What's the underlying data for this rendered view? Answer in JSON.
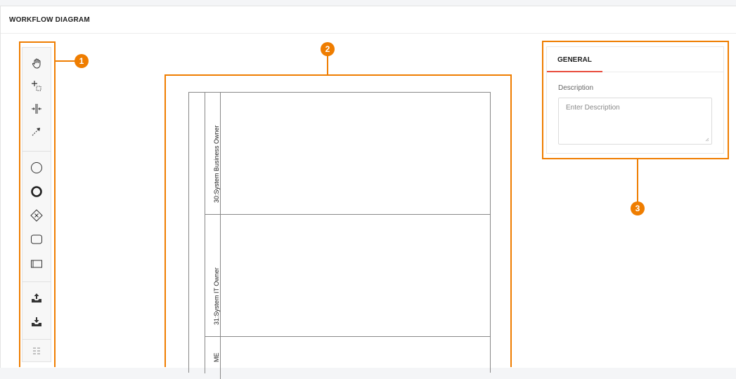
{
  "header": {
    "title": "WORKFLOW DIAGRAM"
  },
  "callouts": [
    "1",
    "2",
    "3"
  ],
  "toolbar": {
    "tools": [
      {
        "icon": "hand-tool-icon"
      },
      {
        "icon": "lasso-tool-icon"
      },
      {
        "icon": "space-tool-icon"
      },
      {
        "icon": "connect-tool-icon"
      },
      {
        "icon": "start-event-icon"
      },
      {
        "icon": "end-event-icon"
      },
      {
        "icon": "gateway-icon"
      },
      {
        "icon": "task-icon"
      },
      {
        "icon": "pool-icon"
      },
      {
        "icon": "upload-icon"
      },
      {
        "icon": "download-icon"
      },
      {
        "icon": "more-options-icon"
      }
    ]
  },
  "canvas": {
    "lanes": [
      {
        "label": "30:System Business Owner"
      },
      {
        "label": "31:System IT Owner"
      },
      {
        "label": "ME"
      }
    ]
  },
  "properties": {
    "tab": "GENERAL",
    "description_label": "Description",
    "description_placeholder": "Enter Description"
  },
  "colors": {
    "highlight": "#ef7d00",
    "tab_accent": "#e84c3d"
  }
}
